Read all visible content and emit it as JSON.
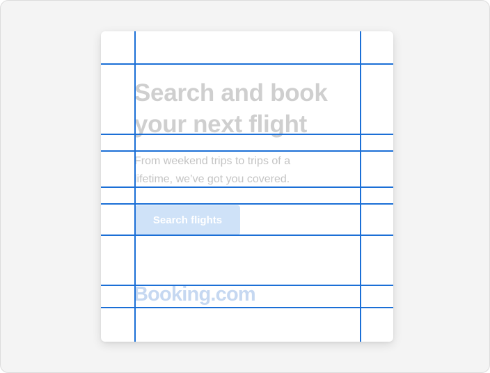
{
  "hero": {
    "title": "Search and book your next flight",
    "subtitle": "From weekend trips to trips of a lifetime, we’ve got you covered.",
    "cta_label": "Search flights"
  },
  "brand": {
    "logo_text": "Booking.com"
  },
  "colors": {
    "title": "#cfcfcf",
    "subtitle": "#c4c4c4",
    "button_bg": "#cfe2f8",
    "button_text": "#ffffff",
    "logo": "#c6d8f1",
    "grid_lines": "#1b6fd6"
  }
}
